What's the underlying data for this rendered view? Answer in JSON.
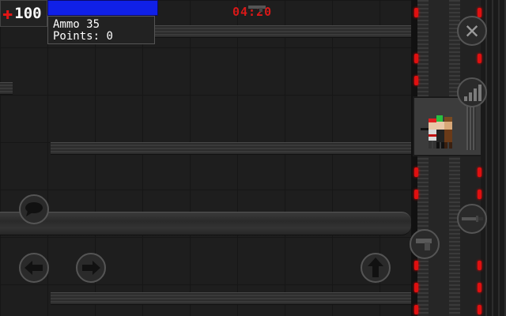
{
  "hud": {
    "health": "100",
    "ammo_label": "Ammo",
    "ammo_value": "35",
    "points_label": "Points",
    "points_value": "0",
    "health_bar_fraction": 1.0,
    "timer": "04:20"
  },
  "controls": {
    "close": "close-icon",
    "signal": "signal-bars-icon",
    "chat": "speech-bubble-icon",
    "left": "arrow-left-icon",
    "right": "arrow-right-icon",
    "jump": "arrow-up-icon",
    "knife": "knife-icon",
    "pistol": "pistol-icon"
  },
  "colors": {
    "health_bar": "#1020e8",
    "warning_light": "#e01010",
    "timer": "#d81818"
  }
}
